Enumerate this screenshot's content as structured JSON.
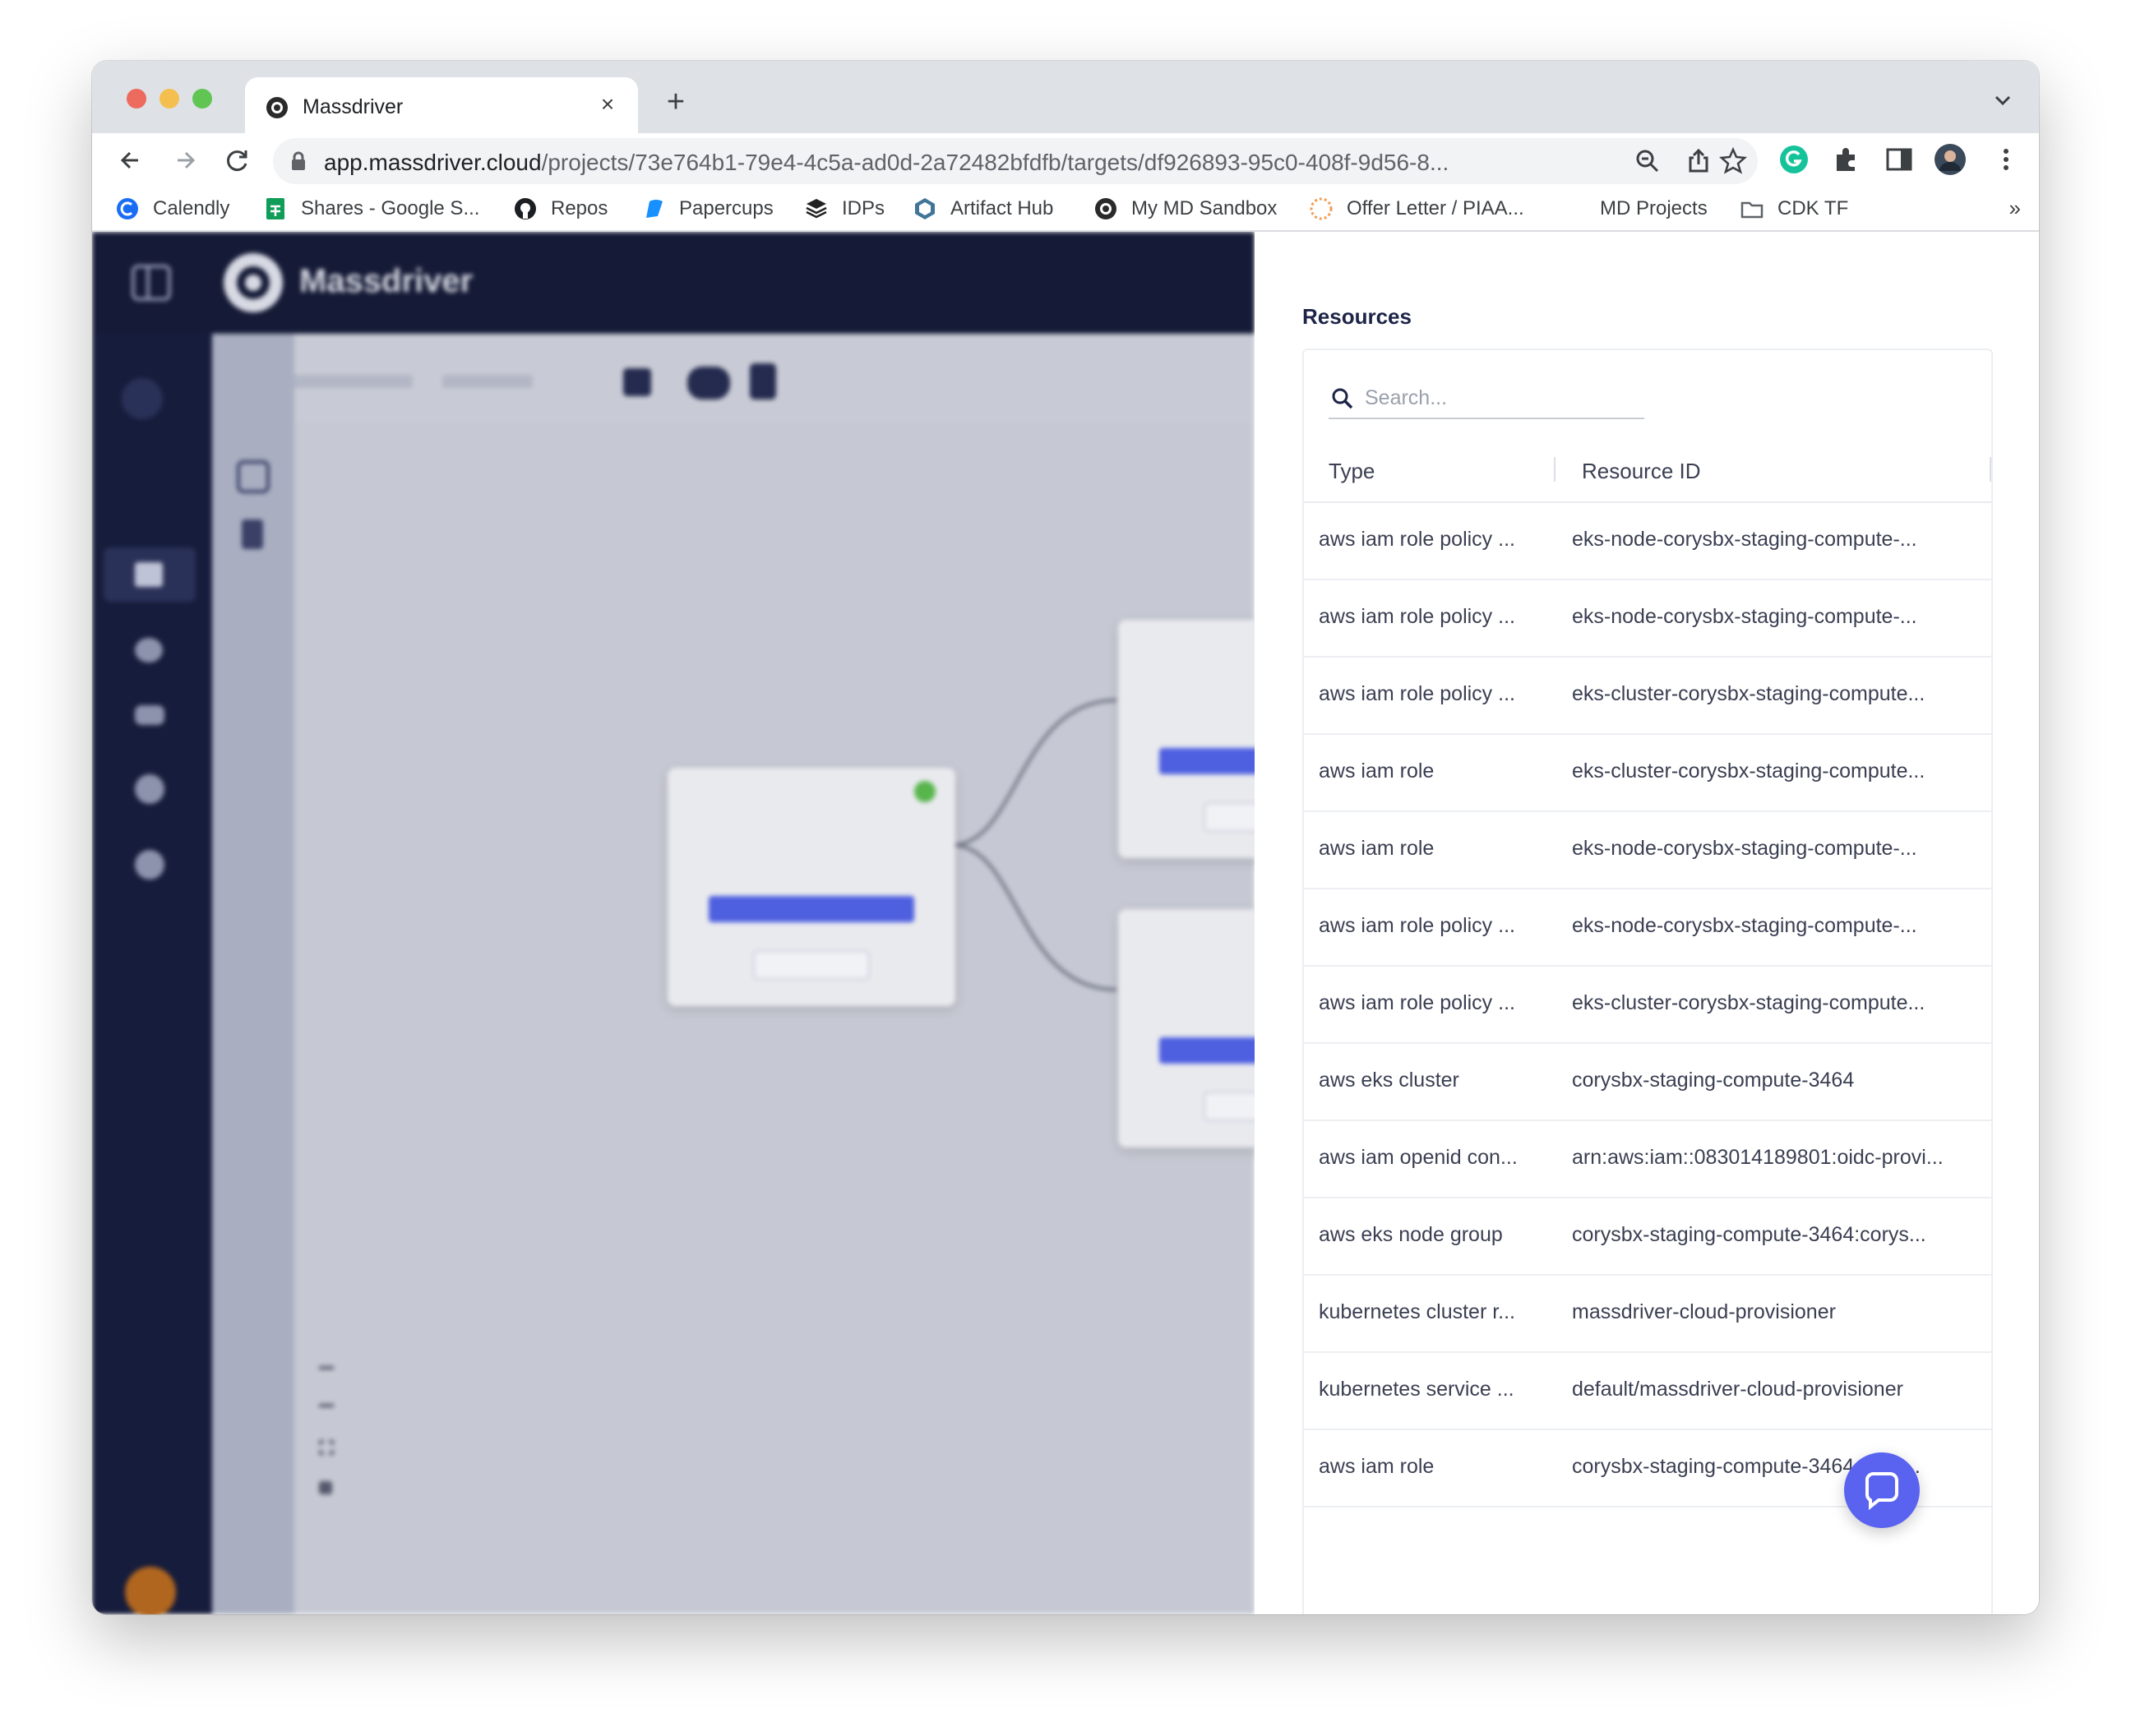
{
  "browser": {
    "tab_title": "Massdriver",
    "url_host": "app.massdriver.cloud",
    "url_path": "/projects/73e764b1-79e4-4c5a-ad0d-2a72482bfdfb/targets/df926893-95c0-408f-9d56-8...",
    "bookmarks": [
      {
        "label": "Calendly",
        "icon": "calendly-icon"
      },
      {
        "label": "Shares - Google S...",
        "icon": "google-sheets-icon"
      },
      {
        "label": "Repos",
        "icon": "github-icon"
      },
      {
        "label": "Papercups",
        "icon": "papercups-icon"
      },
      {
        "label": "IDPs",
        "icon": "idps-icon"
      },
      {
        "label": "Artifact Hub",
        "icon": "artifact-hub-icon"
      },
      {
        "label": "My MD Sandbox",
        "icon": "massdriver-icon"
      },
      {
        "label": "Offer Letter / PIAA...",
        "icon": "offer-letter-icon"
      },
      {
        "label": "MD Projects",
        "icon": ""
      },
      {
        "label": "CDK TF",
        "icon": "folder-icon"
      }
    ],
    "more": "»"
  },
  "background_app": {
    "brand": "Massdriver"
  },
  "resources": {
    "title": "Resources",
    "search_placeholder": "Search...",
    "columns": {
      "type": "Type",
      "resource_id": "Resource ID"
    },
    "rows": [
      {
        "type": "aws iam role policy ...",
        "id": "eks-node-corysbx-staging-compute-..."
      },
      {
        "type": "aws iam role policy ...",
        "id": "eks-node-corysbx-staging-compute-..."
      },
      {
        "type": "aws iam role policy ...",
        "id": "eks-cluster-corysbx-staging-compute..."
      },
      {
        "type": "aws iam role",
        "id": "eks-cluster-corysbx-staging-compute..."
      },
      {
        "type": "aws iam role",
        "id": "eks-node-corysbx-staging-compute-..."
      },
      {
        "type": "aws iam role policy ...",
        "id": "eks-node-corysbx-staging-compute-..."
      },
      {
        "type": "aws iam role policy ...",
        "id": "eks-cluster-corysbx-staging-compute..."
      },
      {
        "type": "aws eks cluster",
        "id": "corysbx-staging-compute-3464"
      },
      {
        "type": "aws iam openid con...",
        "id": "arn:aws:iam::083014189801:oidc-provi..."
      },
      {
        "type": "aws eks node group",
        "id": "corysbx-staging-compute-3464:corys..."
      },
      {
        "type": "kubernetes cluster r...",
        "id": "massdriver-cloud-provisioner"
      },
      {
        "type": "kubernetes service ...",
        "id": "default/massdriver-cloud-provisioner"
      },
      {
        "type": "aws iam role",
        "id": "corysbx-staging-compute-3464-clust..."
      }
    ]
  },
  "colors": {
    "header": "#151a36",
    "accent": "#5a63f0",
    "panel_title": "#1d2447"
  }
}
